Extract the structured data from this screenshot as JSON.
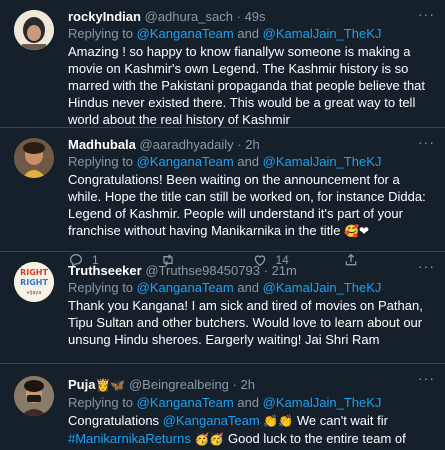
{
  "tweets": [
    {
      "name": "rockyIndian",
      "handle": "@adhura_sach",
      "time": "49s",
      "reply_prefix": "Replying to",
      "reply_to_1": "@KanganaTeam",
      "reply_and": "and",
      "reply_to_2": "@KamalJain_TheKJ",
      "text": "Amazing ! so happy to know fianallyw someone is making a movie on Kashmir's own Legend. The Kashmir history is so marred with the Pakistani propaganda that people believe that Hindus never existed there. This would be a great way to tell world about the real history of Kashmir"
    },
    {
      "name": "Madhubala",
      "handle": "@aaradhyadaily",
      "time": "2h",
      "reply_prefix": "Replying to",
      "reply_to_1": "@KanganaTeam",
      "reply_and": "and",
      "reply_to_2": "@KamalJain_TheKJ",
      "text": "Congratulations! Been waiting on the announcement for a while. Hope the title can still be worked on, for instance Didda: Legend of Kashmir. People will understand it's part of your franchise without having Manikarnika in the title",
      "emoji": "🥰❤",
      "reply_count": "1",
      "like_count": "14"
    },
    {
      "name": "Truthseeker",
      "handle": "@Truthse98450793",
      "time": "21m",
      "reply_prefix": "Replying to",
      "reply_to_1": "@KanganaTeam",
      "reply_and": "and",
      "reply_to_2": "@KamalJain_TheKJ",
      "text": "Thank you Kangana!  I am sick and tired of  movies on Pathan, Tipu Sultan and other butchers. Would love to learn about our unsung Hindu sheroes. Eargerly waiting! Jai Shri Ram",
      "avatar_text": [
        "RIGHT",
        "RIGHT",
        "vijaya"
      ]
    },
    {
      "name": "Puja",
      "name_emoji": "👸🦋",
      "handle": "@Beingrealbeing",
      "time": "2h",
      "reply_prefix": "Replying to",
      "reply_to_1": "@KanganaTeam",
      "reply_and": "and",
      "reply_to_2": "@KamalJain_TheKJ",
      "text_1": "Congratulations",
      "mention": "@KanganaTeam",
      "emoji_1": "👏👏",
      "text_2": "We can't wait fir",
      "hashtag": "#ManikarnikaReturns",
      "emoji_2": "🥳🥳",
      "text_3": "Good luck to the entire team of Manikarnika Returns",
      "emoji_3": "👍👍"
    }
  ],
  "colors": {
    "background": "#15202b",
    "link": "#1da1f2",
    "muted": "#8899a6",
    "divider": "#38444d",
    "like_red": "#e0245e"
  },
  "icons": [
    "more-icon",
    "reply-icon",
    "retweet-icon",
    "like-icon",
    "share-icon"
  ]
}
